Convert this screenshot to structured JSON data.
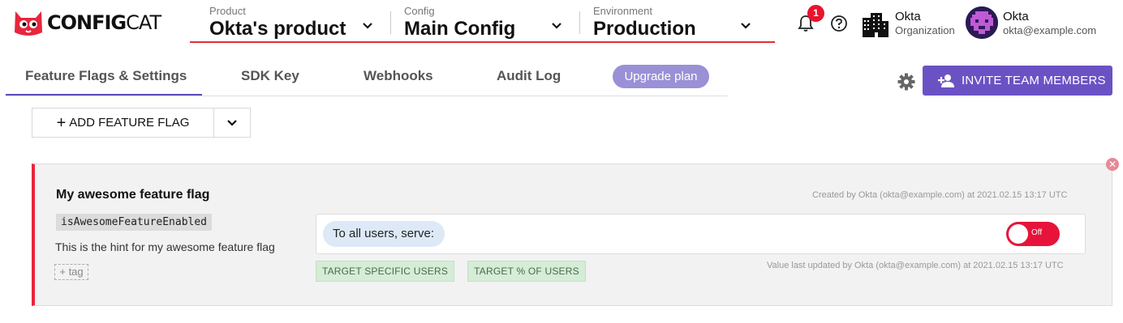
{
  "header": {
    "logo_text_bold": "CONFIG",
    "logo_text_light": "CAT",
    "product": {
      "label": "Product",
      "value": "Okta's product"
    },
    "config": {
      "label": "Config",
      "value": "Main Config"
    },
    "environment": {
      "label": "Environment",
      "value": "Production"
    },
    "notification_count": "1",
    "organization": {
      "name": "Okta",
      "sub": "Organization"
    },
    "user": {
      "name": "Okta",
      "email": "okta@example.com"
    }
  },
  "tabs": [
    {
      "label": "Feature Flags & Settings",
      "active": true
    },
    {
      "label": "SDK Key"
    },
    {
      "label": "Webhooks"
    },
    {
      "label": "Audit Log"
    }
  ],
  "upgrade_label": "Upgrade plan",
  "invite_label": "INVITE TEAM MEMBERS",
  "add_flag_label": "ADD FEATURE FLAG",
  "flag": {
    "name": "My awesome feature flag",
    "key": "isAwesomeFeatureEnabled",
    "hint": "This is the hint for my awesome feature flag",
    "tag_label": "+ tag",
    "created": "Created by Okta (okta@example.com) at 2021.02.15 13:17 UTC",
    "serve_label": "To all users, serve:",
    "toggle_label": "Off",
    "target_users_label": "TARGET SPECIFIC USERS",
    "target_percent_label": "TARGET % OF USERS",
    "updated": "Value last updated by Okta (okta@example.com) at 2021.02.15 13:17 UTC"
  },
  "colors": {
    "accent": "#6b52c4",
    "danger": "#e8133a",
    "target_bg": "#d5ecd6",
    "serve_bg": "#dde9f6"
  },
  "icons": [
    "cat-logo-icon",
    "chevron-down-icon",
    "bell-icon",
    "help-icon",
    "building-icon",
    "gear-icon",
    "add-user-icon",
    "plus-icon",
    "close-icon"
  ]
}
